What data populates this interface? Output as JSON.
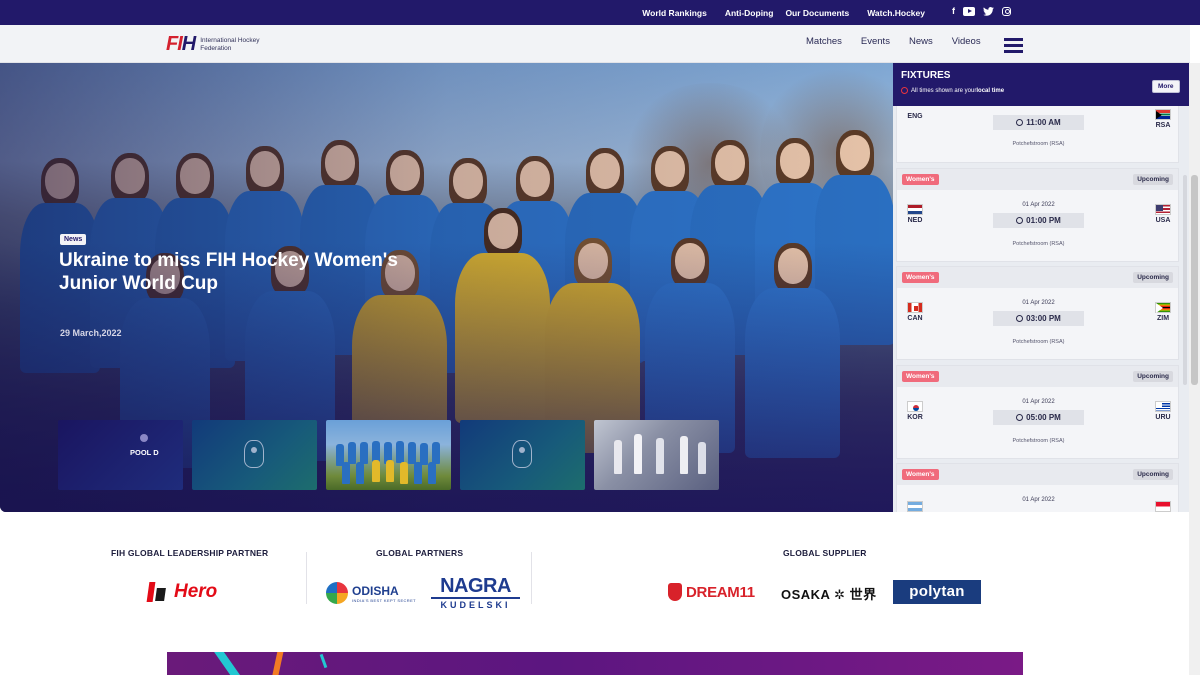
{
  "topbar": {
    "links": [
      "World Rankings",
      "Anti-Doping",
      "Our Documents",
      "Watch.Hockey"
    ],
    "social": [
      "facebook-icon",
      "youtube-icon",
      "twitter-icon",
      "instagram-icon"
    ]
  },
  "nav": {
    "logo_text": "International Hockey Federation",
    "menu": [
      "Matches",
      "Events",
      "News",
      "Videos"
    ]
  },
  "hero": {
    "tag": "News",
    "headline": "Ukraine to miss FIH Hockey Women's Junior World Cup",
    "date": "29 March,2022",
    "thumb1_label": "POOL D"
  },
  "fixtures": {
    "title": "FIXTURES",
    "note_prefix": "All times shown are your ",
    "note_emphasis": "local time",
    "more_label": "More",
    "cards": [
      {
        "category": "",
        "status": "",
        "date": "",
        "home": "ENG",
        "away": "RSA",
        "time": "11:00 AM",
        "venue": "Potchefstroom (RSA)"
      },
      {
        "category": "Women's",
        "status": "Upcoming",
        "date": "01 Apr 2022",
        "home": "NED",
        "away": "USA",
        "time": "01:00 PM",
        "venue": "Potchefstroom (RSA)"
      },
      {
        "category": "Women's",
        "status": "Upcoming",
        "date": "01 Apr 2022",
        "home": "CAN",
        "away": "ZIM",
        "time": "03:00 PM",
        "venue": "Potchefstroom (RSA)"
      },
      {
        "category": "Women's",
        "status": "Upcoming",
        "date": "01 Apr 2022",
        "home": "KOR",
        "away": "URU",
        "time": "05:00 PM",
        "venue": "Potchefstroom (RSA)"
      },
      {
        "category": "Women's",
        "status": "Upcoming",
        "date": "01 Apr 2022",
        "home": "",
        "away": "",
        "time": "",
        "venue": ""
      }
    ]
  },
  "partners": {
    "leadership_title": "FIH GLOBAL LEADERSHIP PARTNER",
    "global_title": "GLOBAL PARTNERS",
    "supplier_title": "GLOBAL SUPPLIER",
    "hero": "Hero",
    "odisha": "ODISHA",
    "odisha_tagline": "INDIA'S BEST KEPT SECRET",
    "nagra": "NAGRA",
    "kudelski": "KUDELSKI",
    "dream11": "DREAM11",
    "osaka": "OSAKA ✲ 世界",
    "polytan": "polytan"
  },
  "colors": {
    "brand_navy": "#22196a",
    "brand_red": "#d4202e",
    "chip_pink": "#f06b7c"
  }
}
